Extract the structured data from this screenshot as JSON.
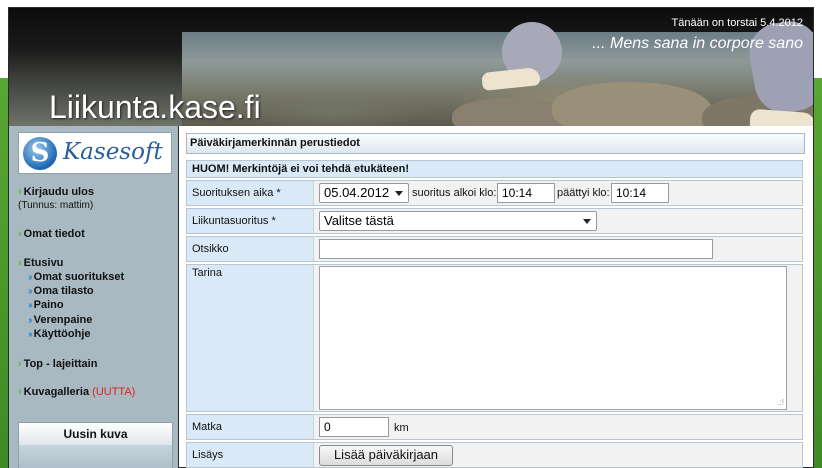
{
  "header": {
    "date_text": "Tänään on torstai 5.4.2012",
    "motto": "... Mens sana in corpore sano",
    "site_title": "Liikunta.kase.fi"
  },
  "sidebar": {
    "logo_text": "Kasesoft",
    "logo_mark": "S",
    "logout_label": "Kirjaudu ulos",
    "account_info": "(Tunnus: mattim)",
    "own_info": "Omat tiedot",
    "home": "Etusivu",
    "subitems": [
      "Omat suoritukset",
      "Oma tilasto",
      "Paino",
      "Verenpaine",
      "Käyttöohje"
    ],
    "top_label": "Top - lajeittain",
    "gallery_label": "Kuvagalleria",
    "gallery_new": "(UUTTA)",
    "newest_image_title": "Uusin kuva"
  },
  "form": {
    "section_title": "Päiväkirjamerkinnän perustiedot",
    "notice": "HUOM! Merkintöjä ei voi tehdä etukäteen!",
    "time_label": "Suorituksen aika *",
    "date_value": "05.04.2012",
    "start_label": "suoritus alkoi klo:",
    "start_value": "10:14",
    "end_label": "päättyi klo:",
    "end_value": "10:14",
    "activity_label": "Liikuntasuoritus *",
    "activity_value": "Valitse tästä",
    "title_label": "Otsikko",
    "title_value": "",
    "story_label": "Tarina",
    "distance_label": "Matka",
    "distance_value": "0",
    "distance_unit": "km",
    "submit_row_label": "Lisäys",
    "submit_button": "Lisää päiväkirjaan"
  },
  "colors": {
    "accent_green": "#5cb82e",
    "sidebar_bg": "#a9b9c1",
    "label_bg": "#d9e9f7",
    "new_tag": "#e02020"
  }
}
